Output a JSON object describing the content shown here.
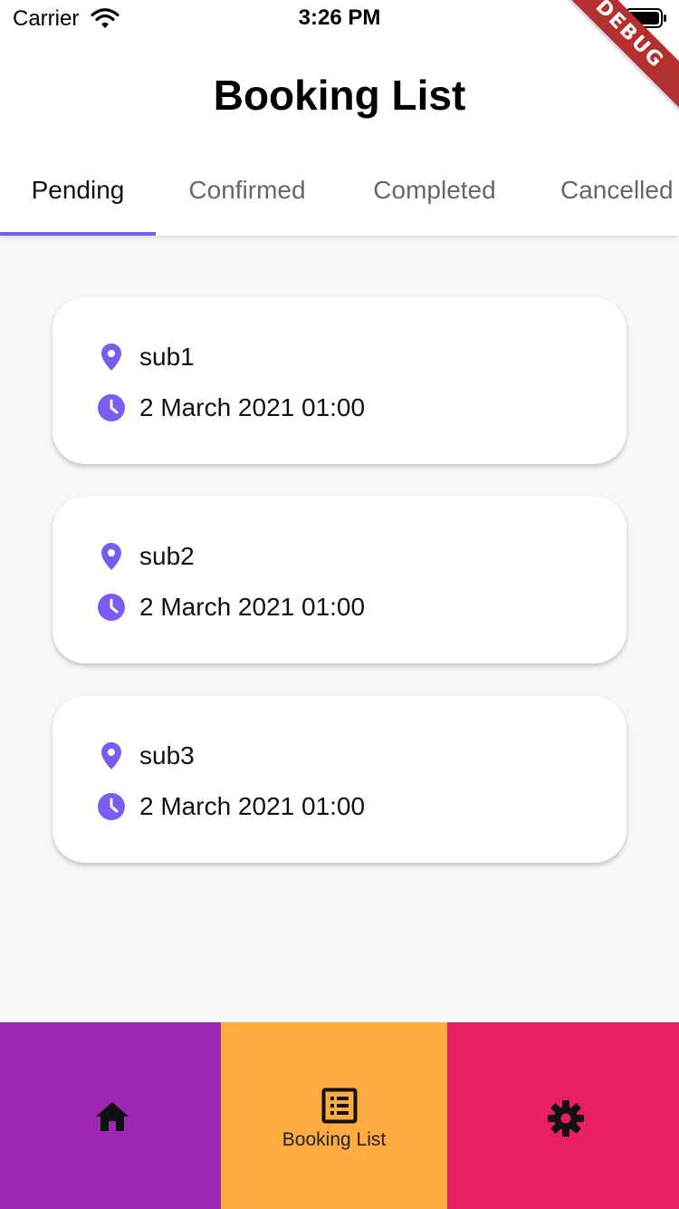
{
  "status_bar": {
    "carrier": "Carrier",
    "time": "3:26 PM"
  },
  "debug_banner": "DEBUG",
  "header": {
    "title": "Booking List"
  },
  "tabs": [
    {
      "label": "Pending",
      "active": true
    },
    {
      "label": "Confirmed",
      "active": false
    },
    {
      "label": "Completed",
      "active": false
    },
    {
      "label": "Cancelled",
      "active": false
    }
  ],
  "bookings": [
    {
      "location": "sub1",
      "datetime": "2 March 2021 01:00"
    },
    {
      "location": "sub2",
      "datetime": "2 March 2021 01:00"
    },
    {
      "location": "sub3",
      "datetime": "2 March 2021 01:00"
    }
  ],
  "bottom_nav": {
    "items": [
      {
        "icon": "home-icon",
        "label": "",
        "color": "#9c27b0"
      },
      {
        "icon": "list-icon",
        "label": "Booking List",
        "color": "#ffab40",
        "selected": true
      },
      {
        "icon": "gear-icon",
        "label": "",
        "color": "#e91e63"
      }
    ]
  },
  "colors": {
    "accent": "#7a5cf0",
    "card_bg": "#ffffff",
    "page_bg": "#f8f8f8"
  }
}
